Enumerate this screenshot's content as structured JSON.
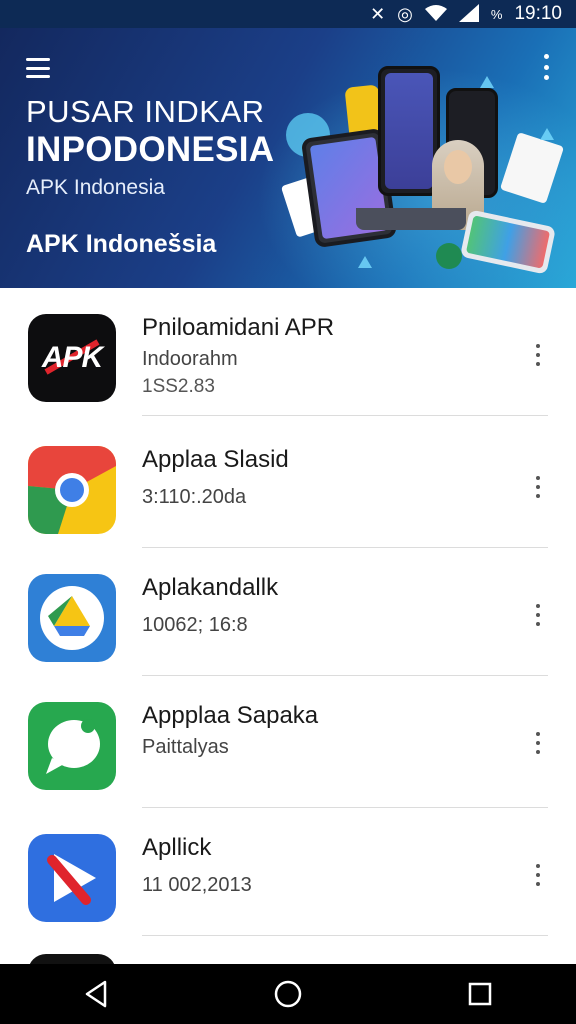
{
  "status_bar": {
    "time": "19:10",
    "battery_label": "%"
  },
  "header": {
    "title_line1": "PUSAR INDKAR",
    "title_line2": "INPODONESIA",
    "subtitle": "APK Indonesia",
    "app_label": "APK Indonešsia"
  },
  "apps": [
    {
      "name": "Pniloamidani APR",
      "meta1": "Indoorahm",
      "meta2": "1SS2.83",
      "icon": "apk-logo-icon"
    },
    {
      "name": "Applaa Slasid",
      "meta1": "3:110:.20da",
      "meta2": "",
      "icon": "chrome-icon"
    },
    {
      "name": "Aplakandallk",
      "meta1": "10062; 16:8",
      "meta2": "",
      "icon": "google-drive-icon"
    },
    {
      "name": "Appplaa Sapaka",
      "meta1": "Paittalyas",
      "meta2": "",
      "icon": "messages-icon"
    },
    {
      "name": "Apllick",
      "meta1": "11 002,2013",
      "meta2": "",
      "icon": "play-store-icon"
    },
    {
      "name": "",
      "meta1": "",
      "meta2": "",
      "icon": "app-icon"
    }
  ],
  "icon_text": {
    "apk": "APK"
  },
  "colors": {
    "header_dark": "#13285e",
    "header_light": "#2aa8d8",
    "accent_red": "#e0242c"
  }
}
